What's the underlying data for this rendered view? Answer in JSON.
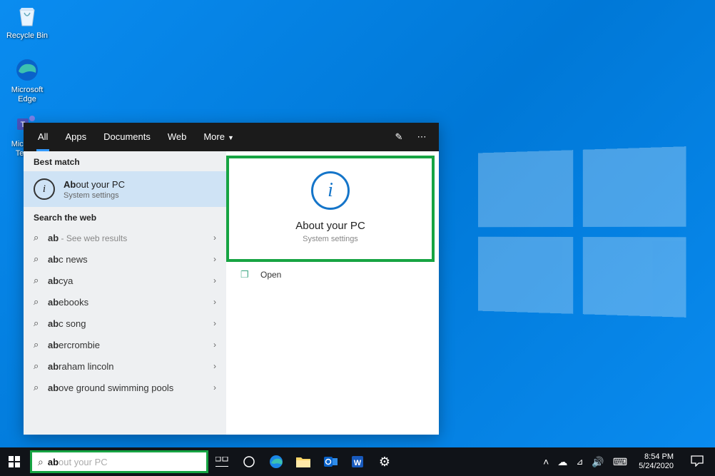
{
  "desktop_icons": {
    "recycle": "Recycle Bin",
    "edge": "Microsoft Edge",
    "teams": "Microsoft Teams"
  },
  "search": {
    "tabs": {
      "all": "All",
      "apps": "Apps",
      "documents": "Documents",
      "web": "Web",
      "more": "More"
    },
    "sections": {
      "best_match": "Best match",
      "search_web": "Search the web"
    },
    "best_match": {
      "title_prefix": "Ab",
      "title_rest": "out your PC",
      "subtitle": "System settings"
    },
    "web_results": [
      {
        "q_bold": "ab",
        "q_rest": "",
        "hint": " - See web results"
      },
      {
        "q_bold": "ab",
        "q_rest": "c news",
        "hint": ""
      },
      {
        "q_bold": "ab",
        "q_rest": "cya",
        "hint": ""
      },
      {
        "q_bold": "ab",
        "q_rest": "ebooks",
        "hint": ""
      },
      {
        "q_bold": "ab",
        "q_rest": "c song",
        "hint": ""
      },
      {
        "q_bold": "ab",
        "q_rest": "ercrombie",
        "hint": ""
      },
      {
        "q_bold": "ab",
        "q_rest": "raham lincoln",
        "hint": ""
      },
      {
        "q_bold": "ab",
        "q_rest": "ove ground swimming pools",
        "hint": ""
      }
    ],
    "preview": {
      "title": "About your PC",
      "subtitle": "System settings",
      "open": "Open"
    },
    "input": {
      "typed": "ab",
      "ghost": "out your PC"
    }
  },
  "tray": {
    "time": "8:54 PM",
    "date": "5/24/2020"
  }
}
